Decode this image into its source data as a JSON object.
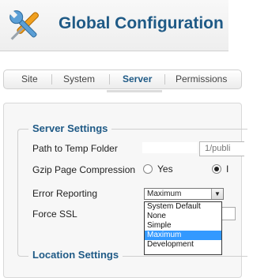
{
  "header": {
    "title": "Global Configuration",
    "icon": "tools-icon"
  },
  "tabs": [
    {
      "label": "Site",
      "active": false
    },
    {
      "label": "System",
      "active": false
    },
    {
      "label": "Server",
      "active": true
    },
    {
      "label": "Permissions",
      "active": false
    }
  ],
  "server_settings": {
    "legend": "Server Settings",
    "temp_folder": {
      "label": "Path to Temp Folder",
      "value": "1/publi"
    },
    "gzip": {
      "label": "Gzip Page Compression",
      "yes_label": "Yes",
      "no_label": "I",
      "selected": "no"
    },
    "error_reporting": {
      "label": "Error Reporting",
      "value": "Maximum",
      "options": [
        "System Default",
        "None",
        "Simple",
        "Maximum",
        "Development"
      ],
      "selected_index": 3
    },
    "force_ssl": {
      "label": "Force SSL"
    }
  },
  "location_settings": {
    "legend": "Location Settings"
  },
  "colors": {
    "accent": "#1f5a86",
    "selection": "#3399ff"
  }
}
